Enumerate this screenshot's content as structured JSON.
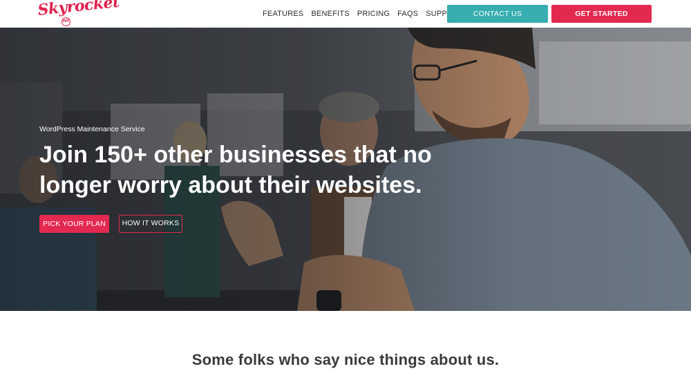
{
  "brand": {
    "logo_text": "Skyrocket",
    "logo_badge": "WP",
    "primary_color": "#e32950",
    "secondary_color": "#36aeb0"
  },
  "nav": {
    "items": [
      {
        "label": "FEATURES"
      },
      {
        "label": "BENEFITS"
      },
      {
        "label": "PRICING"
      },
      {
        "label": "FAQS"
      },
      {
        "label": "SUPPORT"
      }
    ],
    "contact_label": "CONTACT US",
    "get_started_label": "GET STARTED"
  },
  "hero": {
    "eyebrow": "WordPress Maintenance Service",
    "headline": "Join 150+ other businesses that no longer worry about their websites.",
    "primary_cta": "PICK YOUR PLAN",
    "secondary_cta": "HOW IT WORKS",
    "image": "office-meeting-photo"
  },
  "testimonials": {
    "title": "Some folks who say nice things about us."
  }
}
